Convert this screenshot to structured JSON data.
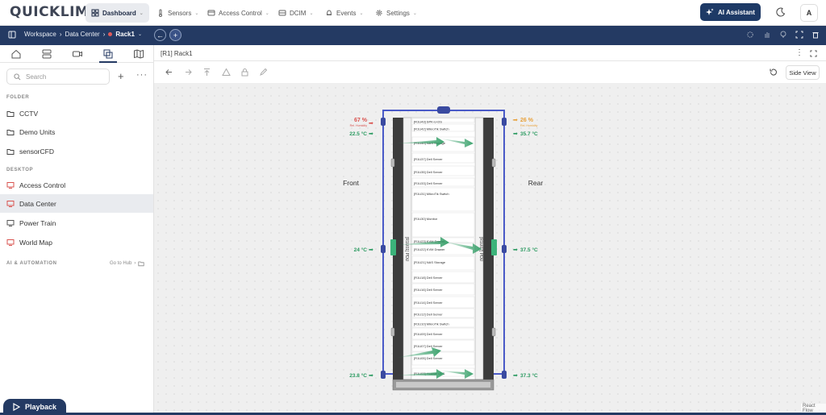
{
  "app": {
    "logo": "QUICKLIME"
  },
  "nav": [
    {
      "label": "Dashboard",
      "icon": "grid-icon",
      "active": true
    },
    {
      "label": "Sensors",
      "icon": "thermometer-icon"
    },
    {
      "label": "Access Control",
      "icon": "card-icon"
    },
    {
      "label": "DCIM",
      "icon": "server-icon"
    },
    {
      "label": "Events",
      "icon": "bell-icon"
    },
    {
      "label": "Settings",
      "icon": "gear-icon"
    }
  ],
  "ai_button": "AI Assistant",
  "avatar": "A",
  "breadcrumb": {
    "workspace": "Workspace",
    "datacenter": "Data Center",
    "rack": "Rack1"
  },
  "sidebar": {
    "search_placeholder": "Search",
    "folder_header": "FOLDER",
    "folders": [
      "CCTV",
      "Demo Units",
      "sensorCFD"
    ],
    "desktop_header": "DESKTOP",
    "desktops": [
      "Access Control",
      "Data Center",
      "Power Train",
      "World Map"
    ],
    "active_desktop": "Data Center",
    "ai_header": "AI & AUTOMATION",
    "go_to_hub": "Go to Hub"
  },
  "panel": {
    "title": "[R1] Rack1",
    "side_view": "Side View"
  },
  "rack": {
    "front_label": "Front",
    "rear_label": "Rear",
    "pdu_left": "[R1U01] PDU",
    "pdu_right": "[R1U02] PDU",
    "sensors": {
      "front_top_humidity": "67 %",
      "front_top_humidity_label": "Rel. Humidity",
      "front_top_temp": "22.5 °C",
      "front_mid_temp": "24 °C",
      "front_bot_temp": "23.8 °C",
      "rear_top_humidity": "26 %",
      "rear_top_humidity_label": "Rel. Humidity",
      "rear_top_temp": "35.7 °C",
      "rear_mid_temp": "37.5 °C",
      "rear_bot_temp": "37.3 °C"
    },
    "devices": [
      "[R1U43] SPK-U-DS",
      "[R1U42] MikroTik Switch",
      "[R1U40] NAS Storage",
      "[R1U37] Dell Server",
      "[R1U35] Dell Server",
      "[R1U33] Dell Server",
      "[R1U31] MikroTik Switch",
      "[R1U30] Monitor",
      "[R1U23] KVM Drawer",
      "[R1U22] KVM Drawer",
      "[R1U21] NAS Storage",
      "[R1U18] Dell Server",
      "[R1U16] Dell Server",
      "[R1U14] Dell Server",
      "[R1U12] Dell Server",
      "[R1U10] MikroTik Switch",
      "[R1U09] Dell Server",
      "[R1U07] Dell Server",
      "[R1U05] Dell Server",
      "[R1U03] Huawei UPS"
    ]
  },
  "playback": "Playback",
  "react_flow": "React Flow",
  "colors": {
    "navy": "#243a63",
    "green": "#2a9a60",
    "red": "#d9534f",
    "orange": "#e8a13a",
    "frame": "#4a5ac8"
  }
}
